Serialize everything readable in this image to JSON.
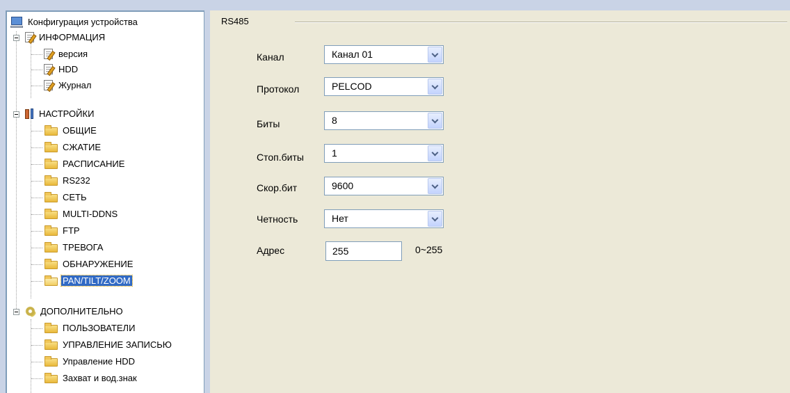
{
  "tree": {
    "root": "Конфигурация устройства",
    "info": {
      "label": "ИНФОРМАЦИЯ",
      "items": [
        "версия",
        "HDD",
        "Журнал"
      ]
    },
    "settings": {
      "label": "НАСТРОЙКИ",
      "items": [
        "ОБЩИЕ",
        "СЖАТИЕ",
        "РАСПИСАНИЕ",
        "RS232",
        "СЕТЬ",
        "MULTI-DDNS",
        "FTP",
        "ТРЕВОГА",
        "ОБНАРУЖЕНИЕ",
        "PAN/TILT/ZOOM"
      ],
      "selected": "PAN/TILT/ZOOM"
    },
    "advanced": {
      "label": "ДОПОЛНИТЕЛЬНО",
      "items": [
        "ПОЛЬЗОВАТЕЛИ",
        "УПРАВЛЕНИЕ ЗАПИСЬЮ",
        "Управление HDD",
        "Захват и вод.знак"
      ]
    }
  },
  "panel": {
    "group_title": "RS485",
    "fields": [
      {
        "label": "Канал",
        "value": "Канал 01"
      },
      {
        "label": "Протокол",
        "value": "PELCOD"
      },
      {
        "label": "Биты",
        "value": "8"
      },
      {
        "label": "Стоп.биты",
        "value": "1"
      },
      {
        "label": "Скор.бит",
        "value": "9600"
      },
      {
        "label": "Четность",
        "value": "Нет"
      }
    ],
    "address": {
      "label": "Адрес",
      "value": "255",
      "range": "0~255"
    }
  },
  "colors": {
    "selection": "#316ac5",
    "panel_bg": "#ece9d8",
    "frame_bg": "#c9d3e6"
  }
}
